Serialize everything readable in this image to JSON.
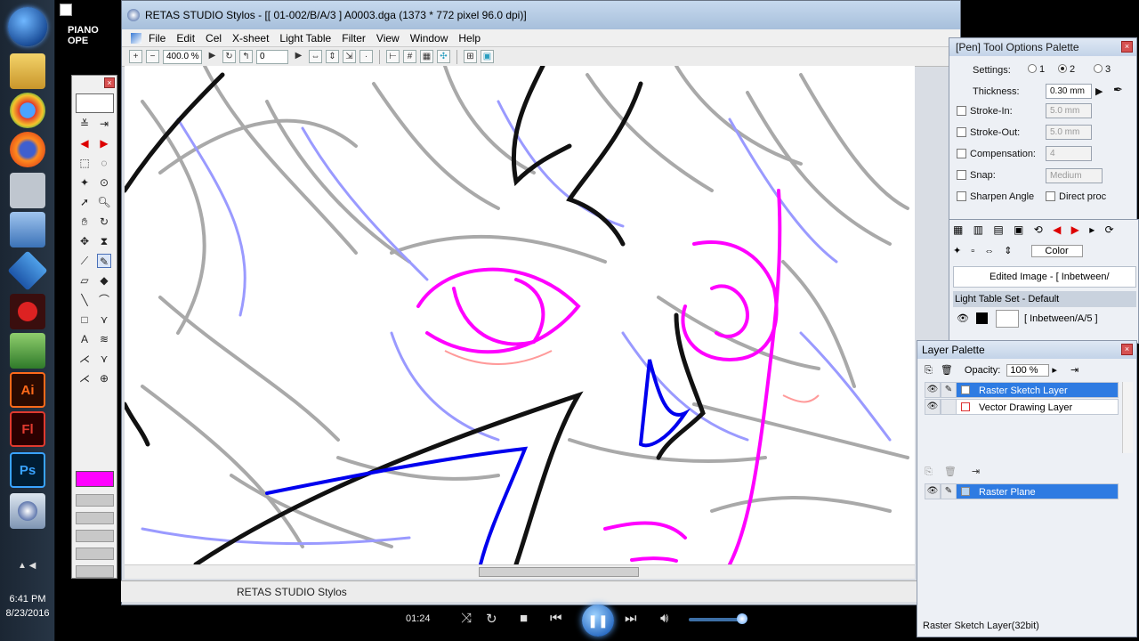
{
  "taskbar": {
    "time": "6:41 PM",
    "date": "8/23/2016",
    "apps": [
      {
        "name": "Ai",
        "color": "#ff6a1a"
      },
      {
        "name": "Fl",
        "color": "#e03a2f"
      },
      {
        "name": "Ps",
        "color": "#39a3ff"
      }
    ]
  },
  "piano_label": "PIANO OPE",
  "window": {
    "title": "RETAS STUDIO Stylos - [[ 01-002/B/A/3 ] A0003.dga (1373 * 772 pixel 96.0 dpi)]",
    "menu": [
      "File",
      "Edit",
      "Cel",
      "X-sheet",
      "Light Table",
      "Filter",
      "View",
      "Window",
      "Help"
    ],
    "zoom": "400.0 %",
    "frame": "0",
    "status": "RETAS STUDIO Stylos"
  },
  "pen_options": {
    "title": "[Pen] Tool Options Palette",
    "settings_label": "Settings:",
    "settings": [
      "1",
      "2",
      "3"
    ],
    "thickness_label": "Thickness:",
    "thickness": "0.30 mm",
    "stroke_in_label": "Stroke-In:",
    "stroke_in": "5.0 mm",
    "stroke_out_label": "Stroke-Out:",
    "stroke_out": "5.0 mm",
    "compensation_label": "Compensation:",
    "compensation": "4",
    "snap_label": "Snap:",
    "snap": "Medium",
    "sharpen_label": "Sharpen Angle",
    "direct_label": "Direct proc"
  },
  "lighttable": {
    "color_label": "Color",
    "edited_image": "Edited Image - [ Inbetween/",
    "set_label": "Light Table Set - Default",
    "entry": "[ Inbetween/A/5 ]"
  },
  "layer_palette": {
    "title": "Layer Palette",
    "opacity_label": "Opacity:",
    "opacity": "100 %",
    "layers": [
      "Raster Sketch Layer",
      "Vector Drawing Layer"
    ],
    "plane": "Raster Plane",
    "status": "Raster Sketch Layer(32bit)"
  },
  "media": {
    "time": "01:24"
  },
  "colors": {
    "current_color": "#ff00ff",
    "selection": "#2e7be2"
  }
}
